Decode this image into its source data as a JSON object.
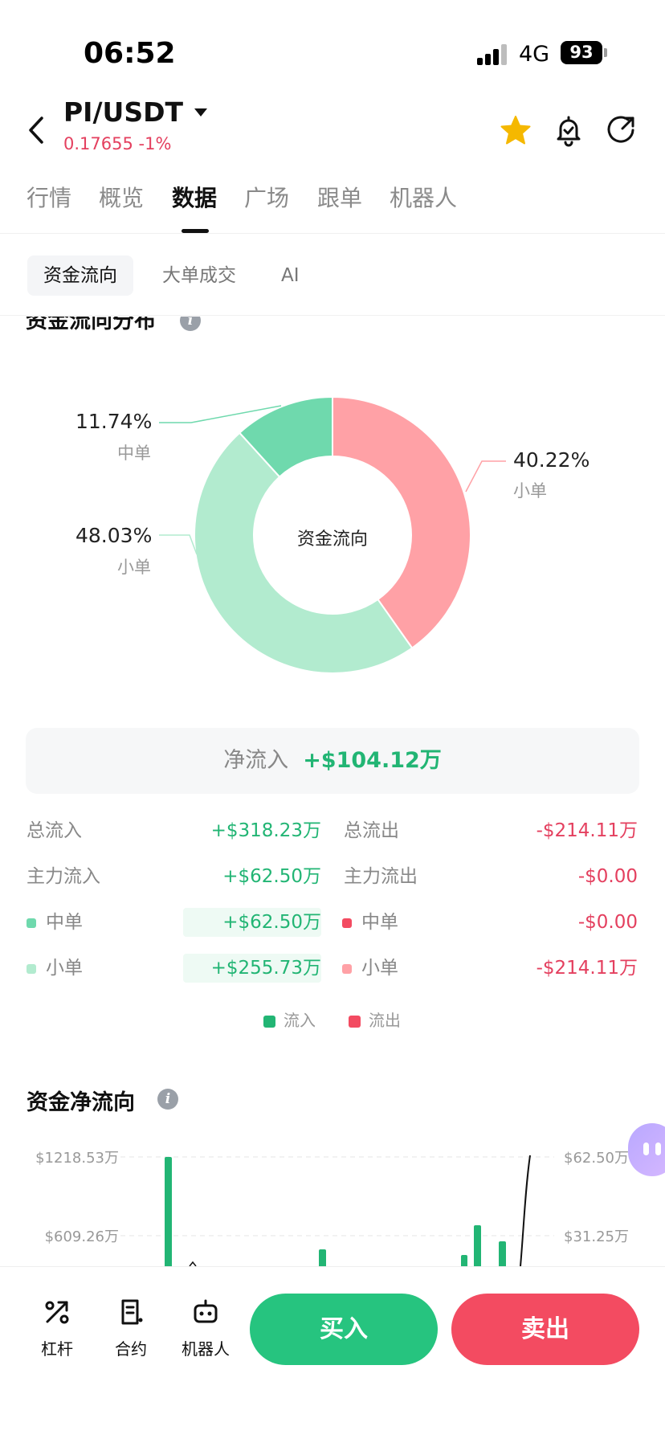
{
  "status_bar": {
    "time": "06:52",
    "network": "4G",
    "battery": "93"
  },
  "header": {
    "pair": "PI/USDT",
    "price_change": "0.17655 -1%",
    "icons": [
      "back-icon",
      "dropdown-icon",
      "star-icon",
      "bell-check-icon",
      "share-icon"
    ],
    "colors": {
      "star": "#f5b800",
      "down": "#e4405f"
    }
  },
  "main_tabs": [
    {
      "label": "行情",
      "active": false
    },
    {
      "label": "概览",
      "active": false
    },
    {
      "label": "数据",
      "active": true
    },
    {
      "label": "广场",
      "active": false
    },
    {
      "label": "跟单",
      "active": false
    },
    {
      "label": "机器人",
      "active": false
    }
  ],
  "sub_tabs": [
    {
      "label": "资金流向",
      "active": true
    },
    {
      "label": "大单成交",
      "active": false
    },
    {
      "label": "AI",
      "active": false
    }
  ],
  "distribution": {
    "title": "资金流向分布",
    "center_label": "资金流向",
    "slices": [
      {
        "category": "小单",
        "percent": "40.22%",
        "value": 40.22,
        "color": "#ffa1a6"
      },
      {
        "category": "小单",
        "percent": "48.03%",
        "value": 48.03,
        "color": "#b2ebcf"
      },
      {
        "category": "中单",
        "percent": "11.74%",
        "value": 11.74,
        "color": "#6fd9ad"
      }
    ]
  },
  "net_inflow": {
    "label": "净流入",
    "value": "+$104.12万"
  },
  "flow_table": {
    "total_in_label": "总流入",
    "total_in": "+$318.23万",
    "total_out_label": "总流出",
    "total_out": "-$214.11万",
    "main_in_label": "主力流入",
    "main_in": "+$62.50万",
    "main_out_label": "主力流出",
    "main_out": "-$0.00",
    "mid_in_label": "中单",
    "mid_in": "+$62.50万",
    "mid_out_label": "中单",
    "mid_out": "-$0.00",
    "small_in_label": "小单",
    "small_in": "+$255.73万",
    "small_out_label": "小单",
    "small_out": "-$214.11万"
  },
  "legend": {
    "in_label": "流入",
    "out_label": "流出",
    "in_color": "#22b574",
    "out_color": "#f34b61"
  },
  "net_flow_chart": {
    "title": "资金净流向",
    "left_ticks": [
      "$1218.53万",
      "$609.26万"
    ],
    "right_ticks": [
      "$62.50万",
      "$31.25万"
    ]
  },
  "chart_data": {
    "type": "pie",
    "title": "资金流向分布",
    "center_label": "资金流向",
    "categories": [
      "小单",
      "小单",
      "中单"
    ],
    "values": [
      40.22,
      48.03,
      11.74
    ],
    "colors": [
      "#ffa1a6",
      "#b2ebcf",
      "#6fd9ad"
    ]
  },
  "bottom_bar": {
    "items": [
      {
        "label": "杠杆",
        "icon": "leverage-icon"
      },
      {
        "label": "合约",
        "icon": "contract-icon"
      },
      {
        "label": "机器人",
        "icon": "robot-icon"
      }
    ],
    "buy_label": "买入",
    "sell_label": "卖出"
  }
}
